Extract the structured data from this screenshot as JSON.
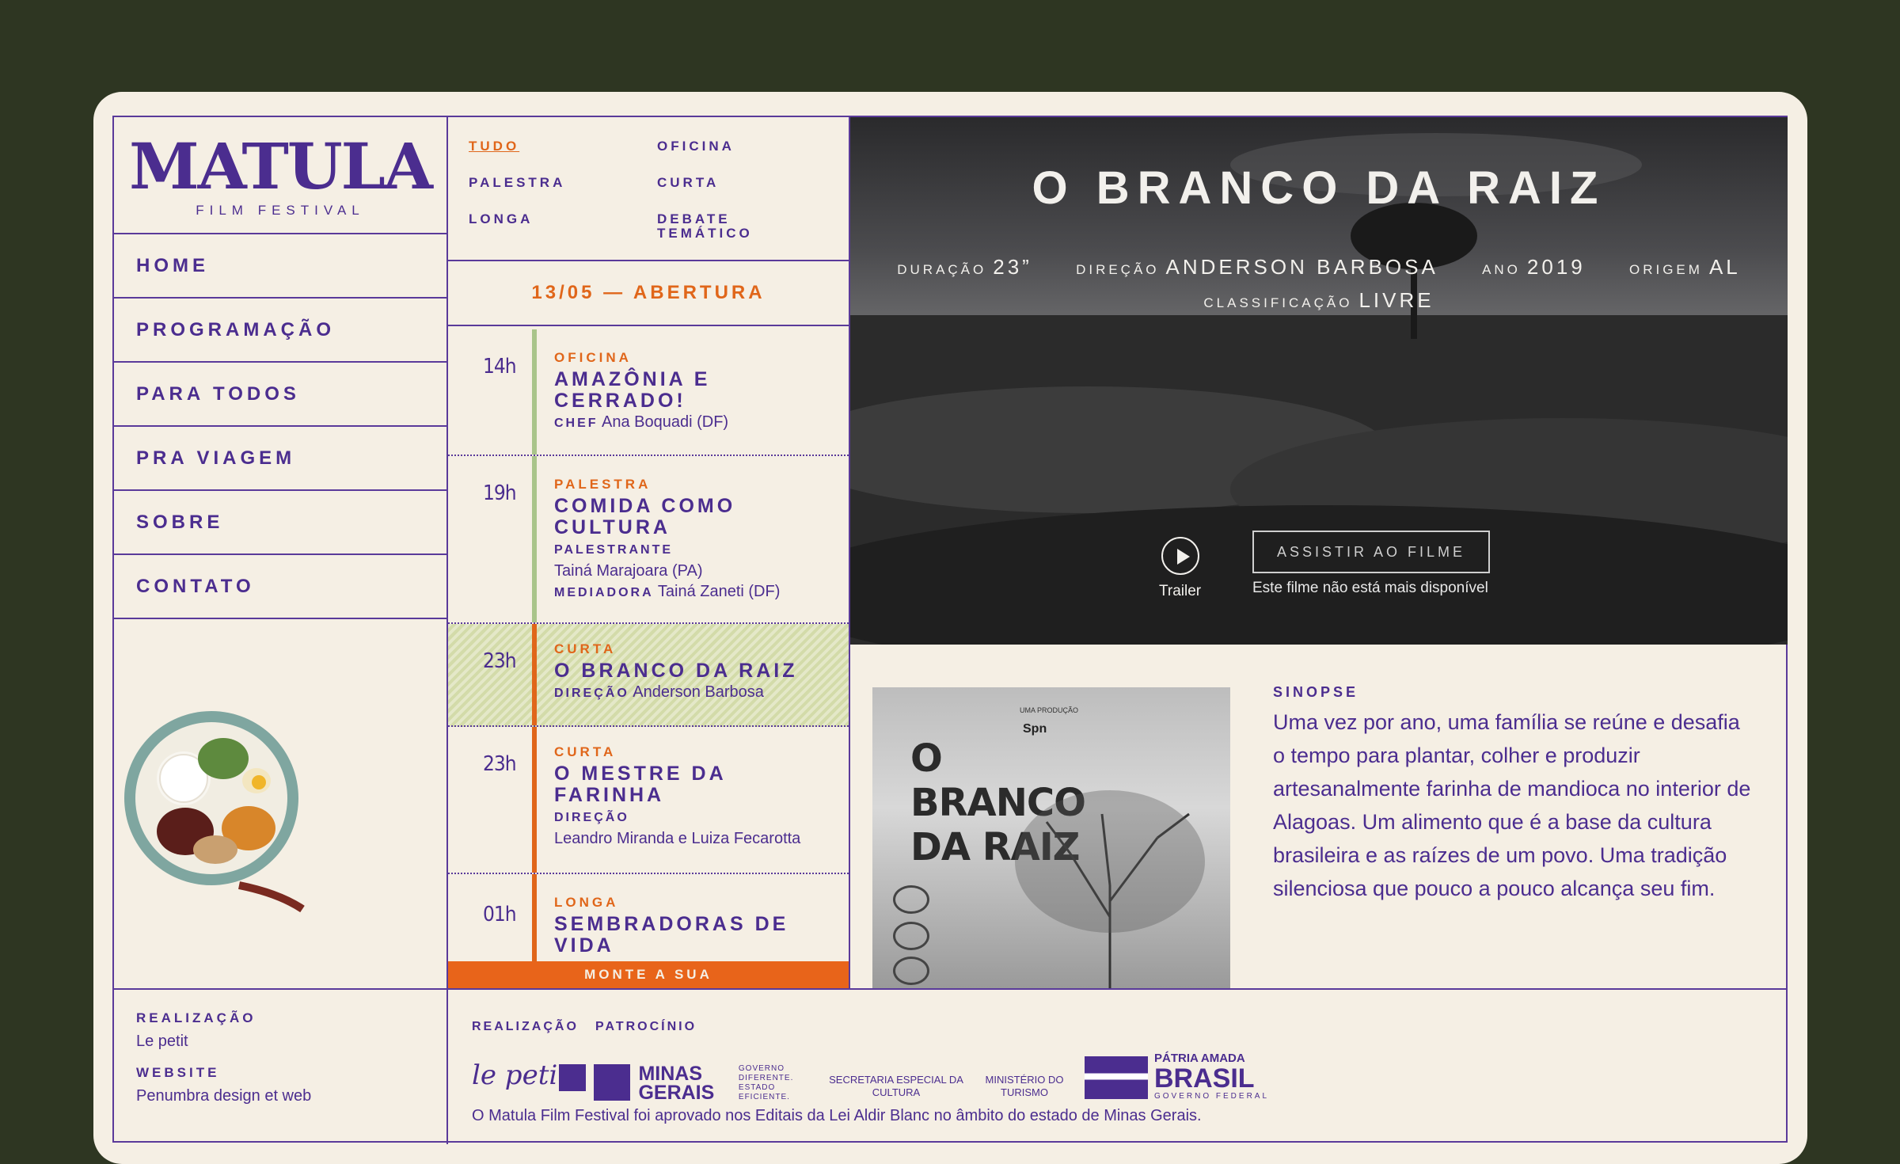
{
  "brand": {
    "name": "MATULA",
    "tagline": "FILM FESTIVAL"
  },
  "nav": [
    "HOME",
    "PROGRAMAÇÃO",
    "PARA TODOS",
    "PRA VIAGEM",
    "SOBRE",
    "CONTATO"
  ],
  "filters": [
    "TUDO",
    "OFICINA",
    "PALESTRA",
    "CURTA",
    "LONGA",
    "DEBATE TEMÁTICO"
  ],
  "date": "13/05 — ABERTURA",
  "events": [
    {
      "time": "14h",
      "category": "OFICINA",
      "title": "AMAZÔNIA E CERRADO!",
      "meta1_label": "CHEF",
      "meta1_value": "Ana Boquadi (DF)"
    },
    {
      "time": "19h",
      "category": "PALESTRA",
      "title": "COMIDA COMO CULTURA",
      "meta1_label": "PALESTRANTE",
      "meta1_value": "Tainá Marajoara (PA)",
      "meta2_label": "MEDIADORA",
      "meta2_value": "Tainá Zaneti (DF)"
    },
    {
      "time": "23h",
      "category": "CURTA",
      "title": "O BRANCO DA RAIZ",
      "meta1_label": "DIREÇÃO",
      "meta1_value": "Anderson Barbosa"
    },
    {
      "time": "23h",
      "category": "CURTA",
      "title": "O MESTRE DA FARINHA",
      "meta1_label": "DIREÇÃO",
      "meta1_value": "Leandro Miranda e Luiza Fecarotta"
    },
    {
      "time": "01h",
      "category": "LONGA",
      "title": "SEMBRADORAS DE VIDA"
    }
  ],
  "cta_bar": "MONTE A SUA",
  "film": {
    "title": "O BRANCO DA RAIZ",
    "duracao_label": "DURAÇÃO",
    "duracao": "23”",
    "direcao_label": "DIREÇÃO",
    "direcao": "ANDERSON BARBOSA",
    "ano_label": "ANO",
    "ano": "2019",
    "origem_label": "ORIGEM",
    "origem": "AL",
    "classificacao_label": "CLASSIFICAÇÃO",
    "classificacao": "LIVRE",
    "trailer": "Trailer",
    "watch_button": "ASSISTIR AO FILME",
    "unavailable": "Este filme não está mais disponível",
    "poster_title": "O BRANCO DA RAIZ",
    "synopsis_label": "SINOPSE",
    "synopsis": "Uma vez por ano, uma família se reúne e desafia o tempo para plantar, colher e produzir artesanalmente farinha de mandioca no interior de Alagoas. Um alimento que é a base da cultura brasileira e as raízes de um povo. Uma tradição silenciosa que pouco a pouco alcança seu fim."
  },
  "footer": {
    "realizacao_label": "REALIZAÇÃO",
    "realizacao": "Le petit",
    "website_label": "WEBSITE",
    "website": "Penumbra design et web",
    "sponsors_realizacao_label": "REALIZAÇÃO",
    "sponsors_patrocinio_label": "PATROCÍNIO",
    "sponsor_lepetit": "le petit",
    "sponsor_minas": "MINAS GERAIS",
    "sponsor_minas_sub": "GOVERNO DIFERENTE. ESTADO EFICIENTE.",
    "sponsor_secretaria": "SECRETARIA ESPECIAL DA CULTURA",
    "sponsor_ministerio": "MINISTÉRIO DO TURISMO",
    "sponsor_patria": "PÁTRIA AMADA",
    "sponsor_brasil": "BRASIL",
    "sponsor_gov": "GOVERNO FEDERAL",
    "note": "O Matula Film Festival foi aprovado nos Editais da Lei Aldir Blanc no âmbito do estado de Minas Gerais."
  },
  "colors": {
    "purple": "#4b2d8f",
    "orange": "#e0661a",
    "cream": "#f5efe4",
    "background": "#2e3622",
    "green": "#a9c48a"
  }
}
